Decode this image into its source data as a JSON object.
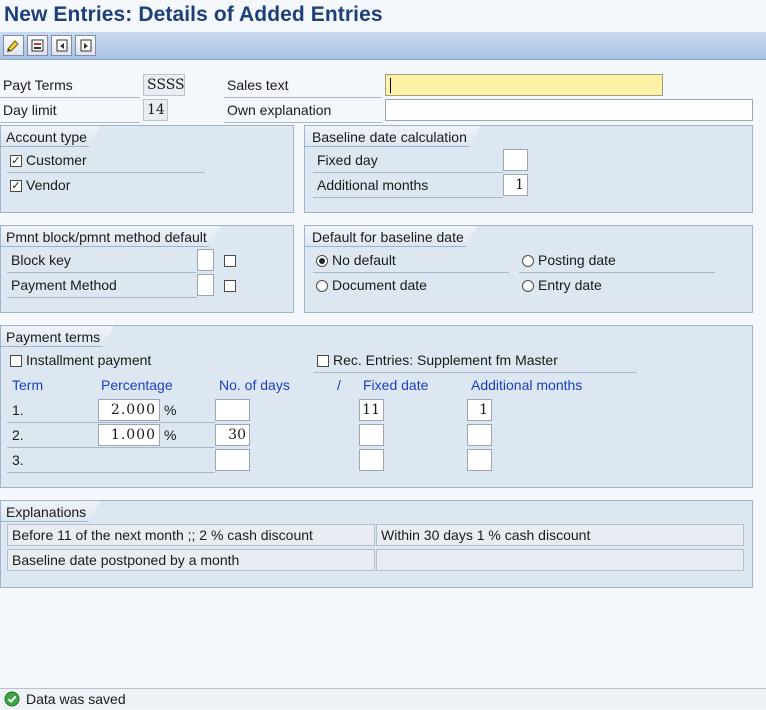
{
  "title": "New Entries: Details of Added Entries",
  "toolbar": {
    "buttons": [
      {
        "name": "edit-glasses-icon"
      },
      {
        "name": "save-variant-icon"
      },
      {
        "name": "previous-entry-icon"
      },
      {
        "name": "next-entry-icon"
      }
    ]
  },
  "header": {
    "payt_terms_label": "Payt Terms",
    "payt_terms_value": "SSSS",
    "day_limit_label": "Day limit",
    "day_limit_value": "14",
    "sales_text_label": "Sales text",
    "sales_text_value": "",
    "own_explanation_label": "Own explanation",
    "own_explanation_value": ""
  },
  "account_type": {
    "title": "Account type",
    "customer_label": "Customer",
    "customer_checked": true,
    "vendor_label": "Vendor",
    "vendor_checked": true
  },
  "baseline_calc": {
    "title": "Baseline date calculation",
    "fixed_day_label": "Fixed day",
    "fixed_day_value": "",
    "additional_months_label": "Additional months",
    "additional_months_value": "1"
  },
  "pmnt_block": {
    "title": "Pmnt block/pmnt method default",
    "block_key_label": "Block key",
    "payment_method_label": "Payment Method"
  },
  "baseline_default": {
    "title": "Default for baseline date",
    "no_default": "No default",
    "posting_date": "Posting date",
    "document_date": "Document date",
    "entry_date": "Entry date",
    "selected": "No default"
  },
  "payment_terms": {
    "title": "Payment terms",
    "installment_label": "Installment payment",
    "rec_entries_label": "Rec. Entries: Supplement fm Master",
    "columns": {
      "term": "Term",
      "percentage": "Percentage",
      "days": "No. of days",
      "slash": "/",
      "fixed_date": "Fixed date",
      "additional_months": "Additional months"
    },
    "percent_sign": "%",
    "rows": [
      {
        "term": "1.",
        "percentage": "2.000",
        "days": "",
        "fixed_date": "11",
        "additional_months": "1"
      },
      {
        "term": "2.",
        "percentage": "1.000",
        "days": "30",
        "fixed_date": "",
        "additional_months": ""
      },
      {
        "term": "3.",
        "percentage": "",
        "days": "",
        "fixed_date": "",
        "additional_months": ""
      }
    ]
  },
  "explanations": {
    "title": "Explanations",
    "line1_left": "Before 11 of the next month ;; 2 % cash discount",
    "line1_right": "Within 30 days 1 % cash discount",
    "line2_left": "Baseline date postponed by a month",
    "line2_right": ""
  },
  "status": {
    "message": "Data was saved"
  }
}
